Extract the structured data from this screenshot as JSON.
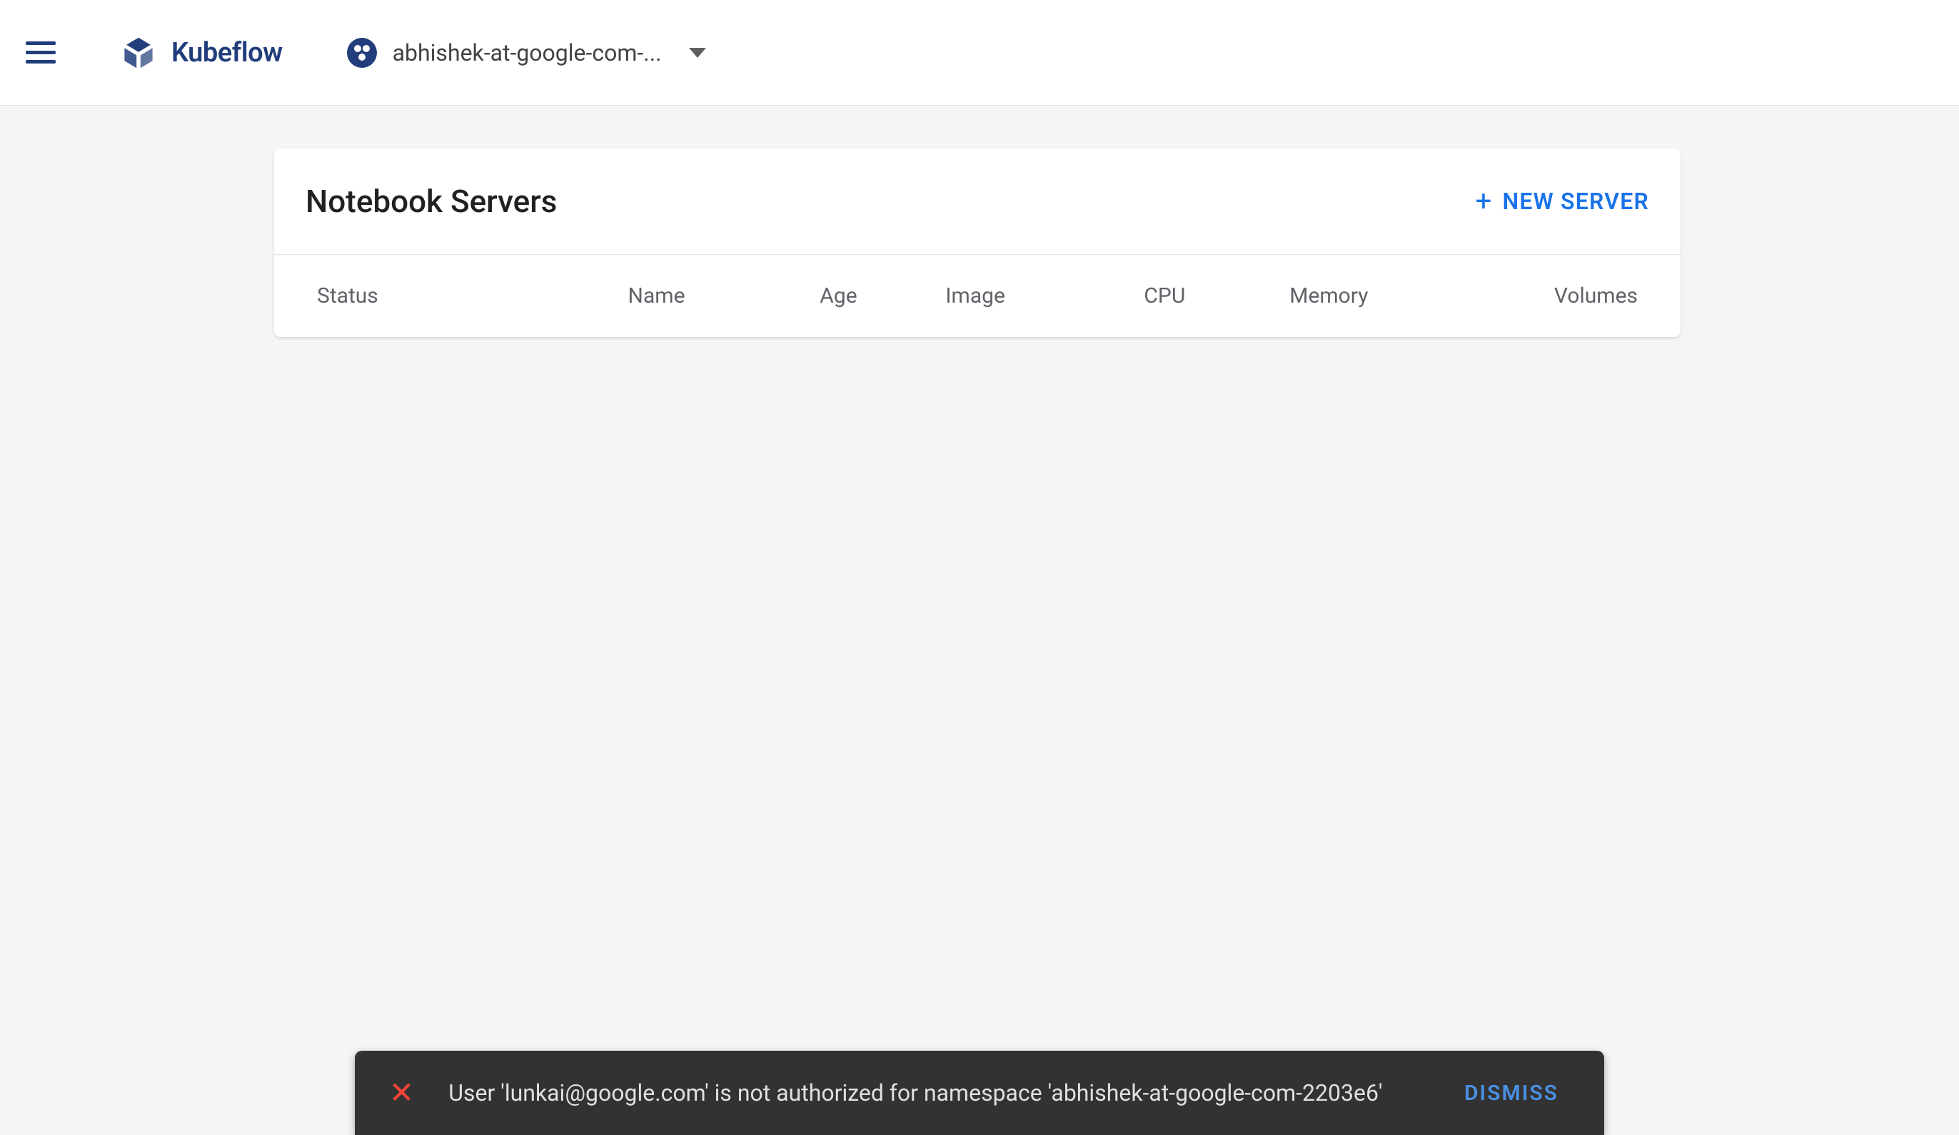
{
  "header": {
    "brand": "Kubeflow",
    "namespace": "abhishek-at-google-com-..."
  },
  "card": {
    "title": "Notebook Servers",
    "new_server_label": "NEW SERVER"
  },
  "table": {
    "columns": {
      "status": "Status",
      "name": "Name",
      "age": "Age",
      "image": "Image",
      "cpu": "CPU",
      "memory": "Memory",
      "volumes": "Volumes"
    },
    "rows": []
  },
  "snackbar": {
    "message": "User 'lunkai@google.com' is not authorized for namespace 'abhishek-at-google-com-2203e6'",
    "dismiss_label": "DISMISS"
  }
}
